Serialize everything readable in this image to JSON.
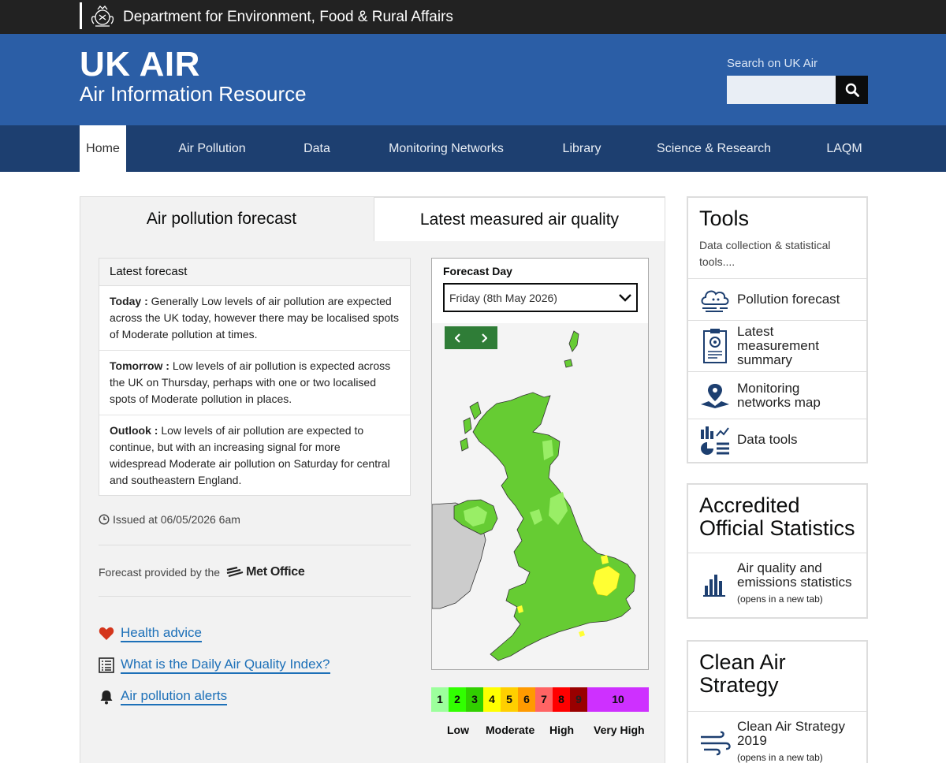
{
  "govbar": {
    "department": "Department for Environment, Food & Rural Affairs"
  },
  "header": {
    "title": "UK AIR",
    "subtitle": "Air Information Resource",
    "search_label": "Search on UK Air",
    "search_placeholder": ""
  },
  "nav": {
    "items": [
      {
        "label": "Home",
        "active": true
      },
      {
        "label": "Air Pollution"
      },
      {
        "label": "Data"
      },
      {
        "label": "Monitoring Networks"
      },
      {
        "label": "Library"
      },
      {
        "label": "Science & Research"
      },
      {
        "label": "LAQM"
      }
    ]
  },
  "tabs": {
    "forecast": "Air pollution forecast",
    "measured": "Latest measured air quality"
  },
  "forecast": {
    "heading": "Latest forecast",
    "entries": [
      {
        "label": "Today :",
        "text": " Generally Low levels of air pollution are expected across the UK today, however there may be localised spots of Moderate pollution at times."
      },
      {
        "label": "Tomorrow :",
        "text": " Low levels of air pollution is expected across the UK on Thursday, perhaps with one or two localised spots of Moderate pollution in places."
      },
      {
        "label": "Outlook :",
        "text": " Low levels of air pollution are expected to continue, but with an increasing signal for more widespread Moderate air pollution on Saturday for central and southeastern England."
      }
    ],
    "issued": "Issued at 06/05/2026 6am",
    "provided_by": "Forecast provided by the",
    "provider": "Met Office"
  },
  "links": [
    {
      "label": "Health advice",
      "icon": "heart-icon"
    },
    {
      "label": "What is the Daily Air Quality Index?",
      "icon": "list-icon"
    },
    {
      "label": "Air pollution alerts",
      "icon": "bell-icon"
    }
  ],
  "map": {
    "forecast_day_label": "Forecast Day",
    "selected_day": "Friday (8th May 2026)",
    "colors": {
      "low": "#66cc33",
      "low_light": "#99ee66",
      "moderate": "#ffff33",
      "land_other": "#cccccc"
    }
  },
  "daqi": {
    "cells": [
      {
        "value": "1",
        "color": "#9cff9c"
      },
      {
        "value": "2",
        "color": "#31ff00"
      },
      {
        "value": "3",
        "color": "#31cf00"
      },
      {
        "value": "4",
        "color": "#ffff00"
      },
      {
        "value": "5",
        "color": "#ffcf00"
      },
      {
        "value": "6",
        "color": "#ff9a00"
      },
      {
        "value": "7",
        "color": "#ff6464"
      },
      {
        "value": "8",
        "color": "#ff0000"
      },
      {
        "value": "9",
        "color": "#990000"
      },
      {
        "value": "10",
        "color": "#ce30ff"
      }
    ],
    "bands": [
      "Low",
      "Moderate",
      "High",
      "Very High"
    ]
  },
  "tools": {
    "title": "Tools",
    "description": "Data collection & statistical tools....",
    "items": [
      {
        "label": "Pollution forecast",
        "icon": "cloud-forecast-icon"
      },
      {
        "label": "Latest measurement summary",
        "icon": "clipboard-icon"
      },
      {
        "label": "Monitoring networks map",
        "icon": "map-pin-icon"
      },
      {
        "label": "Data tools",
        "icon": "charts-icon"
      }
    ]
  },
  "statistics": {
    "title": "Accredited Official Statistics",
    "item_label": "Air quality and emissions statistics",
    "item_note": "(opens in a new tab)"
  },
  "clean_air": {
    "title": "Clean Air Strategy",
    "item_label": "Clean Air Strategy 2019",
    "item_note": "(opens in a new tab)"
  }
}
